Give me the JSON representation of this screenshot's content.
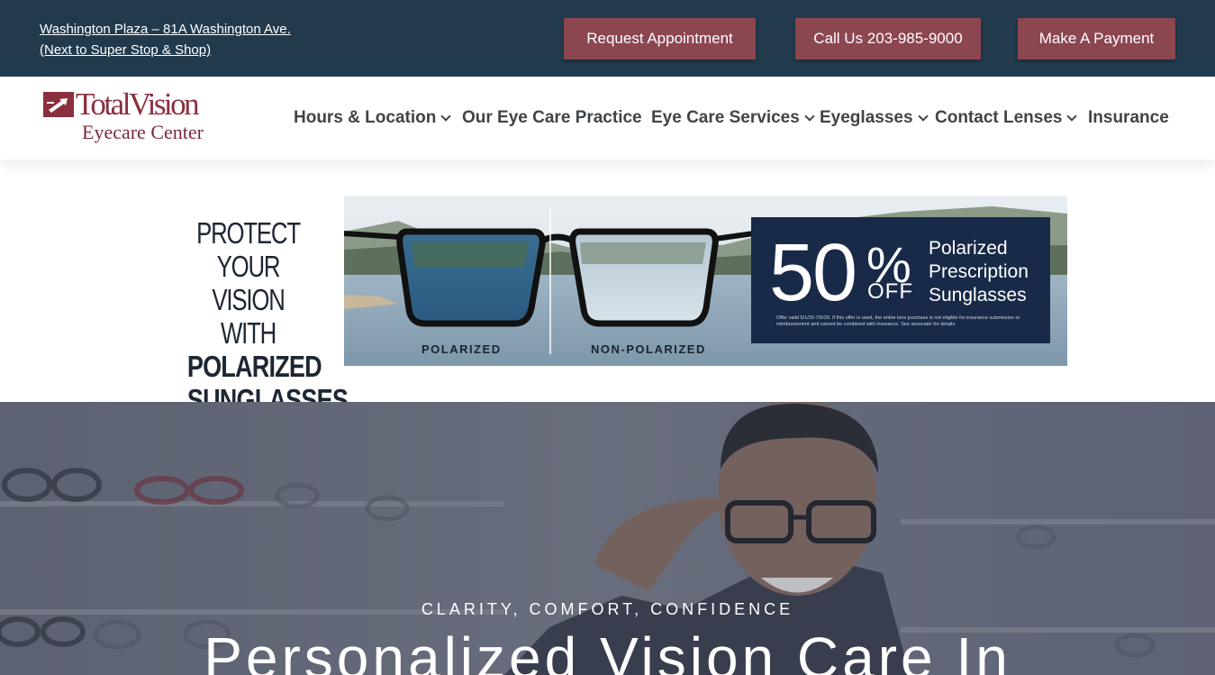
{
  "topbar": {
    "address_line1": "Washington Plaza – 81A Washington Ave.",
    "address_line2": "(Next to Super Stop & Shop)",
    "request_button": "Request Appointment",
    "call_button": "Call Us 203-985-9000",
    "payment_button": "Make A Payment"
  },
  "logo": {
    "name": "TotalVision",
    "subtitle": "Eyecare Center",
    "color": "#8a2f3f"
  },
  "nav": {
    "items": [
      {
        "label": "Hours & Location",
        "has_dropdown": true
      },
      {
        "label": "Our Eye Care Practice",
        "has_dropdown": false
      },
      {
        "label": "Eye Care Services",
        "has_dropdown": true
      },
      {
        "label": "Eyeglasses",
        "has_dropdown": true
      },
      {
        "label": "Contact Lenses",
        "has_dropdown": true
      },
      {
        "label": "Insurance",
        "has_dropdown": false
      }
    ]
  },
  "promo": {
    "headline_line1": "PROTECT YOUR",
    "headline_line2": "VISION WITH",
    "headline_line3": "POLARIZED",
    "headline_line4": "SUNGLASSES",
    "left_lens_label": "POLARIZED",
    "right_lens_label": "NON-POLARIZED",
    "offer_number": "50",
    "offer_percent": "%",
    "offer_off": "OFF",
    "offer_desc_line1": "Polarized",
    "offer_desc_line2": "Prescription",
    "offer_desc_line3": "Sunglasses",
    "offer_fine_print": "Offer valid 5/1/26-7/5/26. If this offer is used, the entire lens purchase is not eligible for insurance submission or reimbursement and cannot be combined with insurance. See associate for details."
  },
  "hero": {
    "subtitle": "CLARITY, COMFORT, CONFIDENCE",
    "title": "Personalized Vision Care In"
  },
  "colors": {
    "topbar_bg": "#223a4c",
    "button_bg": "#8c4650",
    "nav_text": "#3f4448",
    "offer_box": "#182a48"
  }
}
